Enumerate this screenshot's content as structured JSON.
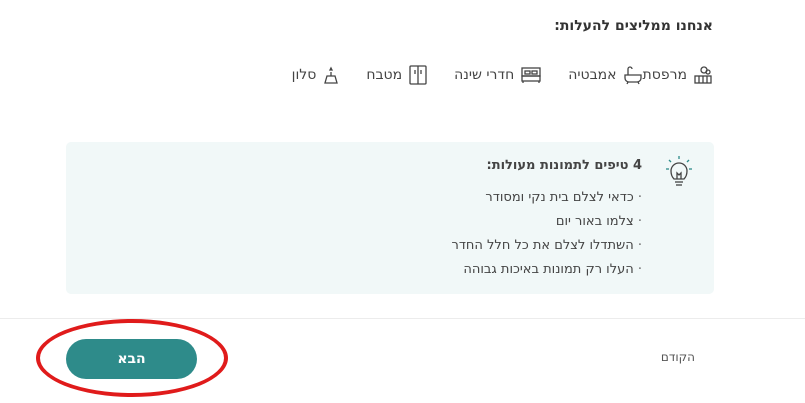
{
  "recommend": {
    "title": "אנחנו ממליצים להעלות:",
    "rooms": [
      {
        "label": "מרפסת",
        "icon": "balcony-icon"
      },
      {
        "label": "אמבטיה",
        "icon": "bathtub-icon"
      },
      {
        "label": "חדרי שינה",
        "icon": "bed-icon"
      },
      {
        "label": "מטבח",
        "icon": "fridge-icon"
      },
      {
        "label": "סלון",
        "icon": "lamp-icon"
      }
    ]
  },
  "tips": {
    "icon": "lightbulb-icon",
    "title": "4 טיפים לתמונות מעולות:",
    "items": [
      "כדאי לצלם בית נקי ומסודר",
      "צלמו באור יום",
      "השתדלו לצלם את כל חלל החדר",
      "העלו רק תמונות באיכות גבוהה"
    ]
  },
  "footer": {
    "prev_label": "הקודם",
    "next_label": "הבא"
  },
  "colors": {
    "accent": "#2e8b8a",
    "tips_bg": "#f1f8f8",
    "highlight": "#e01b1b"
  }
}
